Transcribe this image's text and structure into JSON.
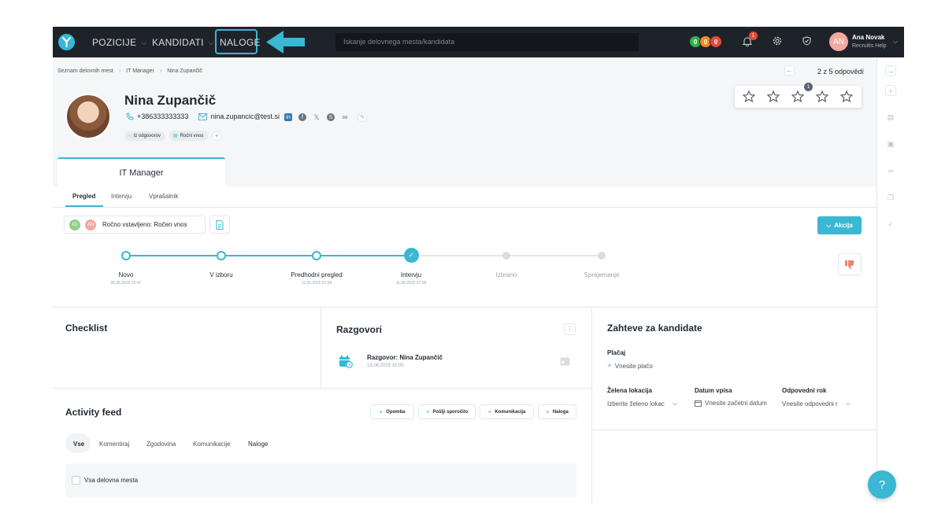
{
  "nav": {
    "positions": "POZICIJE",
    "candidates": "KANDIDATI",
    "tasks": "NALOGE",
    "search_placeholder": "Iskanje delovnega mesta/kandidata",
    "counters": [
      {
        "value": "0",
        "color": "#2fb34a"
      },
      {
        "value": "0",
        "color": "#f08a24"
      },
      {
        "value": "0",
        "color": "#e24a3b"
      }
    ],
    "notifications_count": "1",
    "user": {
      "initials": "AN",
      "name": "Ana Novak",
      "org": "Recruitis Help"
    }
  },
  "breadcrumb": [
    "Seznam delovnih mest",
    "IT Manager",
    "Nina Zupančič"
  ],
  "pager_text": "2 z 5 odpovědí",
  "rating": {
    "count_badge": "1",
    "stars": 5
  },
  "candidate": {
    "name": "Nina Zupančič",
    "phone": "+386333333333",
    "email": "nina.zupancic@test.si",
    "tags": [
      "Iz odgovorov",
      "Ročni vnos"
    ]
  },
  "job_tab": "IT Manager",
  "subtabs": [
    "Pregled",
    "Intervju",
    "Vprašalnik"
  ],
  "status": {
    "avatar1": "IO",
    "avatar2": "AN",
    "text": "Ročno vstavljeno: Ročen vnos"
  },
  "action_button": "Akcija",
  "pipeline": [
    {
      "label": "Novo",
      "date": "05.06.2025 10:47",
      "state": "done"
    },
    {
      "label": "V izboru",
      "date": "",
      "state": "done"
    },
    {
      "label": "Predhodni pregled",
      "date": "11.06.2025 07:58",
      "state": "done"
    },
    {
      "label": "Intervju",
      "date": "11.06.2025 07:58",
      "state": "current"
    },
    {
      "label": "Izbrano",
      "date": "",
      "state": "pending"
    },
    {
      "label": "Sprejemanje",
      "date": "",
      "state": "pending"
    }
  ],
  "checklist": {
    "title": "Checklist"
  },
  "conversations": {
    "title": "Razgovori",
    "item_title": "Razgovor: Nina Zupančič",
    "item_date": "13.06.2025 10:00"
  },
  "requirements": {
    "title": "Zahteve za kandidate",
    "salary_label": "Plačaj",
    "salary_placeholder": "Vnesite plačo",
    "location_label": "Želena lokacija",
    "location_value": "Izberite želeno lokac",
    "start_label": "Datum vpisa",
    "start_value": "Vnesite začetni datum",
    "notice_label": "Odpovedni rok",
    "notice_value": "Vnesite odpovedni r"
  },
  "activity": {
    "title": "Activity feed",
    "buttons": [
      "Opomba",
      "Pošlji sporočilo",
      "Komunikacija",
      "Naloga"
    ],
    "tabs": [
      "Vse",
      "Komentiraj",
      "Zgodovina",
      "Komunikacije",
      "Naloge"
    ],
    "filter_label": "Vsa delovna mesta"
  },
  "help": "?"
}
